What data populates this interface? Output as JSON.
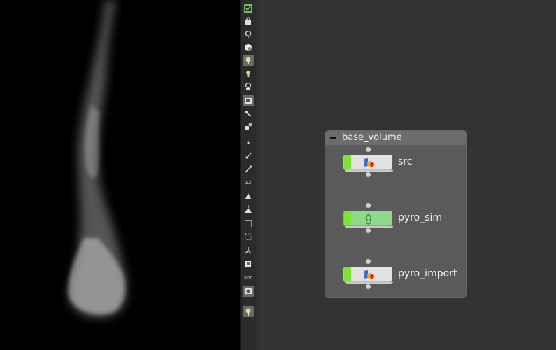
{
  "netbox": {
    "title": "base_volume"
  },
  "nodes": [
    {
      "label": "src",
      "icon": "object-merge-icon"
    },
    {
      "label": "pyro_sim",
      "icon": "pyro-solver-icon"
    },
    {
      "label": "pyro_import",
      "icon": "object-merge-icon"
    }
  ],
  "toolbar": {
    "tool_12_label": "12",
    "tool_abc_label": "abc"
  },
  "colors": {
    "network_bg": "#333333",
    "netbox_bg": "#5a5a5a",
    "display_flag": "#7ee43c",
    "sim_node": "#8fd98a"
  }
}
